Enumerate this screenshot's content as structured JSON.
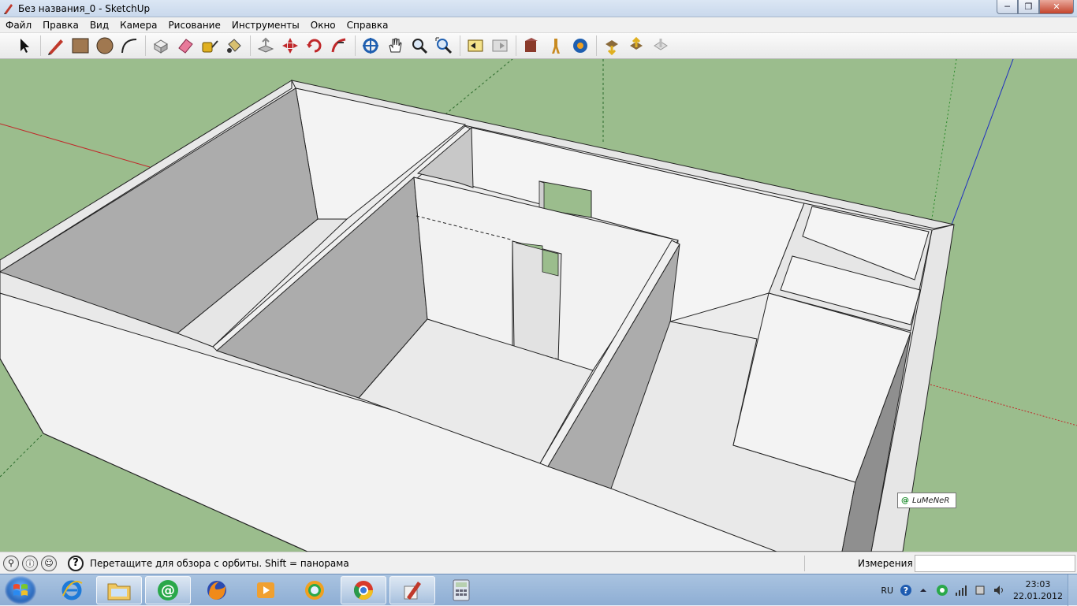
{
  "window": {
    "title": "Без названия_0 - SketchUp"
  },
  "menu": [
    {
      "label": "Файл"
    },
    {
      "label": "Правка"
    },
    {
      "label": "Вид"
    },
    {
      "label": "Камера"
    },
    {
      "label": "Рисование"
    },
    {
      "label": "Инструменты"
    },
    {
      "label": "Окно"
    },
    {
      "label": "Справка"
    }
  ],
  "toolbar_icons": [
    "select-arrow-icon",
    "pencil-line-icon",
    "rectangle-icon",
    "circle-icon",
    "arc-icon",
    "make-component-icon",
    "eraser-icon",
    "tape-measure-icon",
    "paint-bucket-icon",
    "push-pull-icon",
    "move-icon",
    "rotate-icon",
    "follow-me-icon",
    "orbit-icon",
    "pan-hand-icon",
    "zoom-icon",
    "zoom-extents-icon",
    "previous-view-icon",
    "next-view-icon",
    "position-camera-icon",
    "walk-icon",
    "look-around-icon",
    "get-models-icon",
    "share-model-icon",
    "share-component-icon"
  ],
  "viewport": {
    "background_color": "#9bbd8d",
    "credit_text": "LuMeNeR"
  },
  "statusbar": {
    "hint": "Перетащите для обзора с орбиты.  Shift = панорама",
    "measure_label": "Измерения",
    "measure_value": ""
  },
  "taskbar": {
    "apps": [
      "ie-icon",
      "explorer-folder-icon",
      "mail-agent-icon",
      "firefox-icon",
      "media-player-icon",
      "chromium-icon",
      "chrome-icon",
      "sketchup-icon",
      "calculator-icon"
    ],
    "lang": "RU",
    "time": "23:03",
    "date": "22.01.2012"
  }
}
